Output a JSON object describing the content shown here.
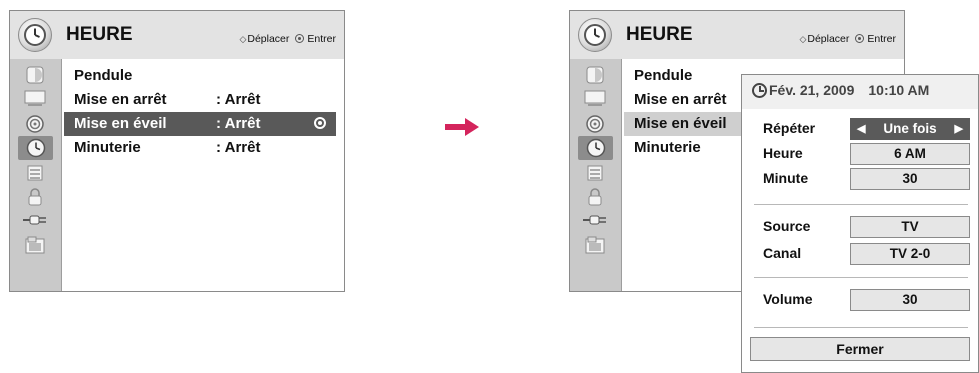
{
  "left_screen": {
    "title": "HEURE",
    "nav_move": "Déplacer",
    "nav_enter": "Entrer",
    "menu": [
      {
        "label": "Pendule",
        "value": ""
      },
      {
        "label": "Mise en arrêt",
        "value": ": Arrêt"
      },
      {
        "label": "Mise en éveil",
        "value": ": Arrêt",
        "selected": true
      },
      {
        "label": "Minuterie",
        "value": ": Arrêt"
      }
    ]
  },
  "right_screen": {
    "title": "HEURE",
    "nav_move": "Déplacer",
    "nav_enter": "Entrer",
    "menu": [
      {
        "label": "Pendule"
      },
      {
        "label": "Mise en arrêt"
      },
      {
        "label": "Mise en éveil",
        "highlighted": true
      },
      {
        "label": "Minuterie"
      }
    ],
    "popup": {
      "date": "Fév. 21, 2009",
      "time": "10:10 AM",
      "fields": [
        {
          "label": "Répéter",
          "value": "Une fois",
          "active": true
        },
        {
          "label": "Heure",
          "value": "6 AM"
        },
        {
          "label": "Minute",
          "value": "30"
        },
        {
          "label": "Source",
          "value": "TV"
        },
        {
          "label": "Canal",
          "value": "TV 2-0"
        },
        {
          "label": "Volume",
          "value": "30"
        }
      ],
      "close_label": "Fermer"
    }
  },
  "sidebar_icons": [
    "picture-icon",
    "screen-icon",
    "audio-icon",
    "clock-icon",
    "option-icon",
    "lock-icon",
    "input-icon",
    "usb-icon"
  ],
  "colors": {
    "arrow": "#d4245c",
    "selection": "#595959",
    "sidebar_active": "#8c8c8c",
    "panel_bg": "#e3e3e3"
  }
}
